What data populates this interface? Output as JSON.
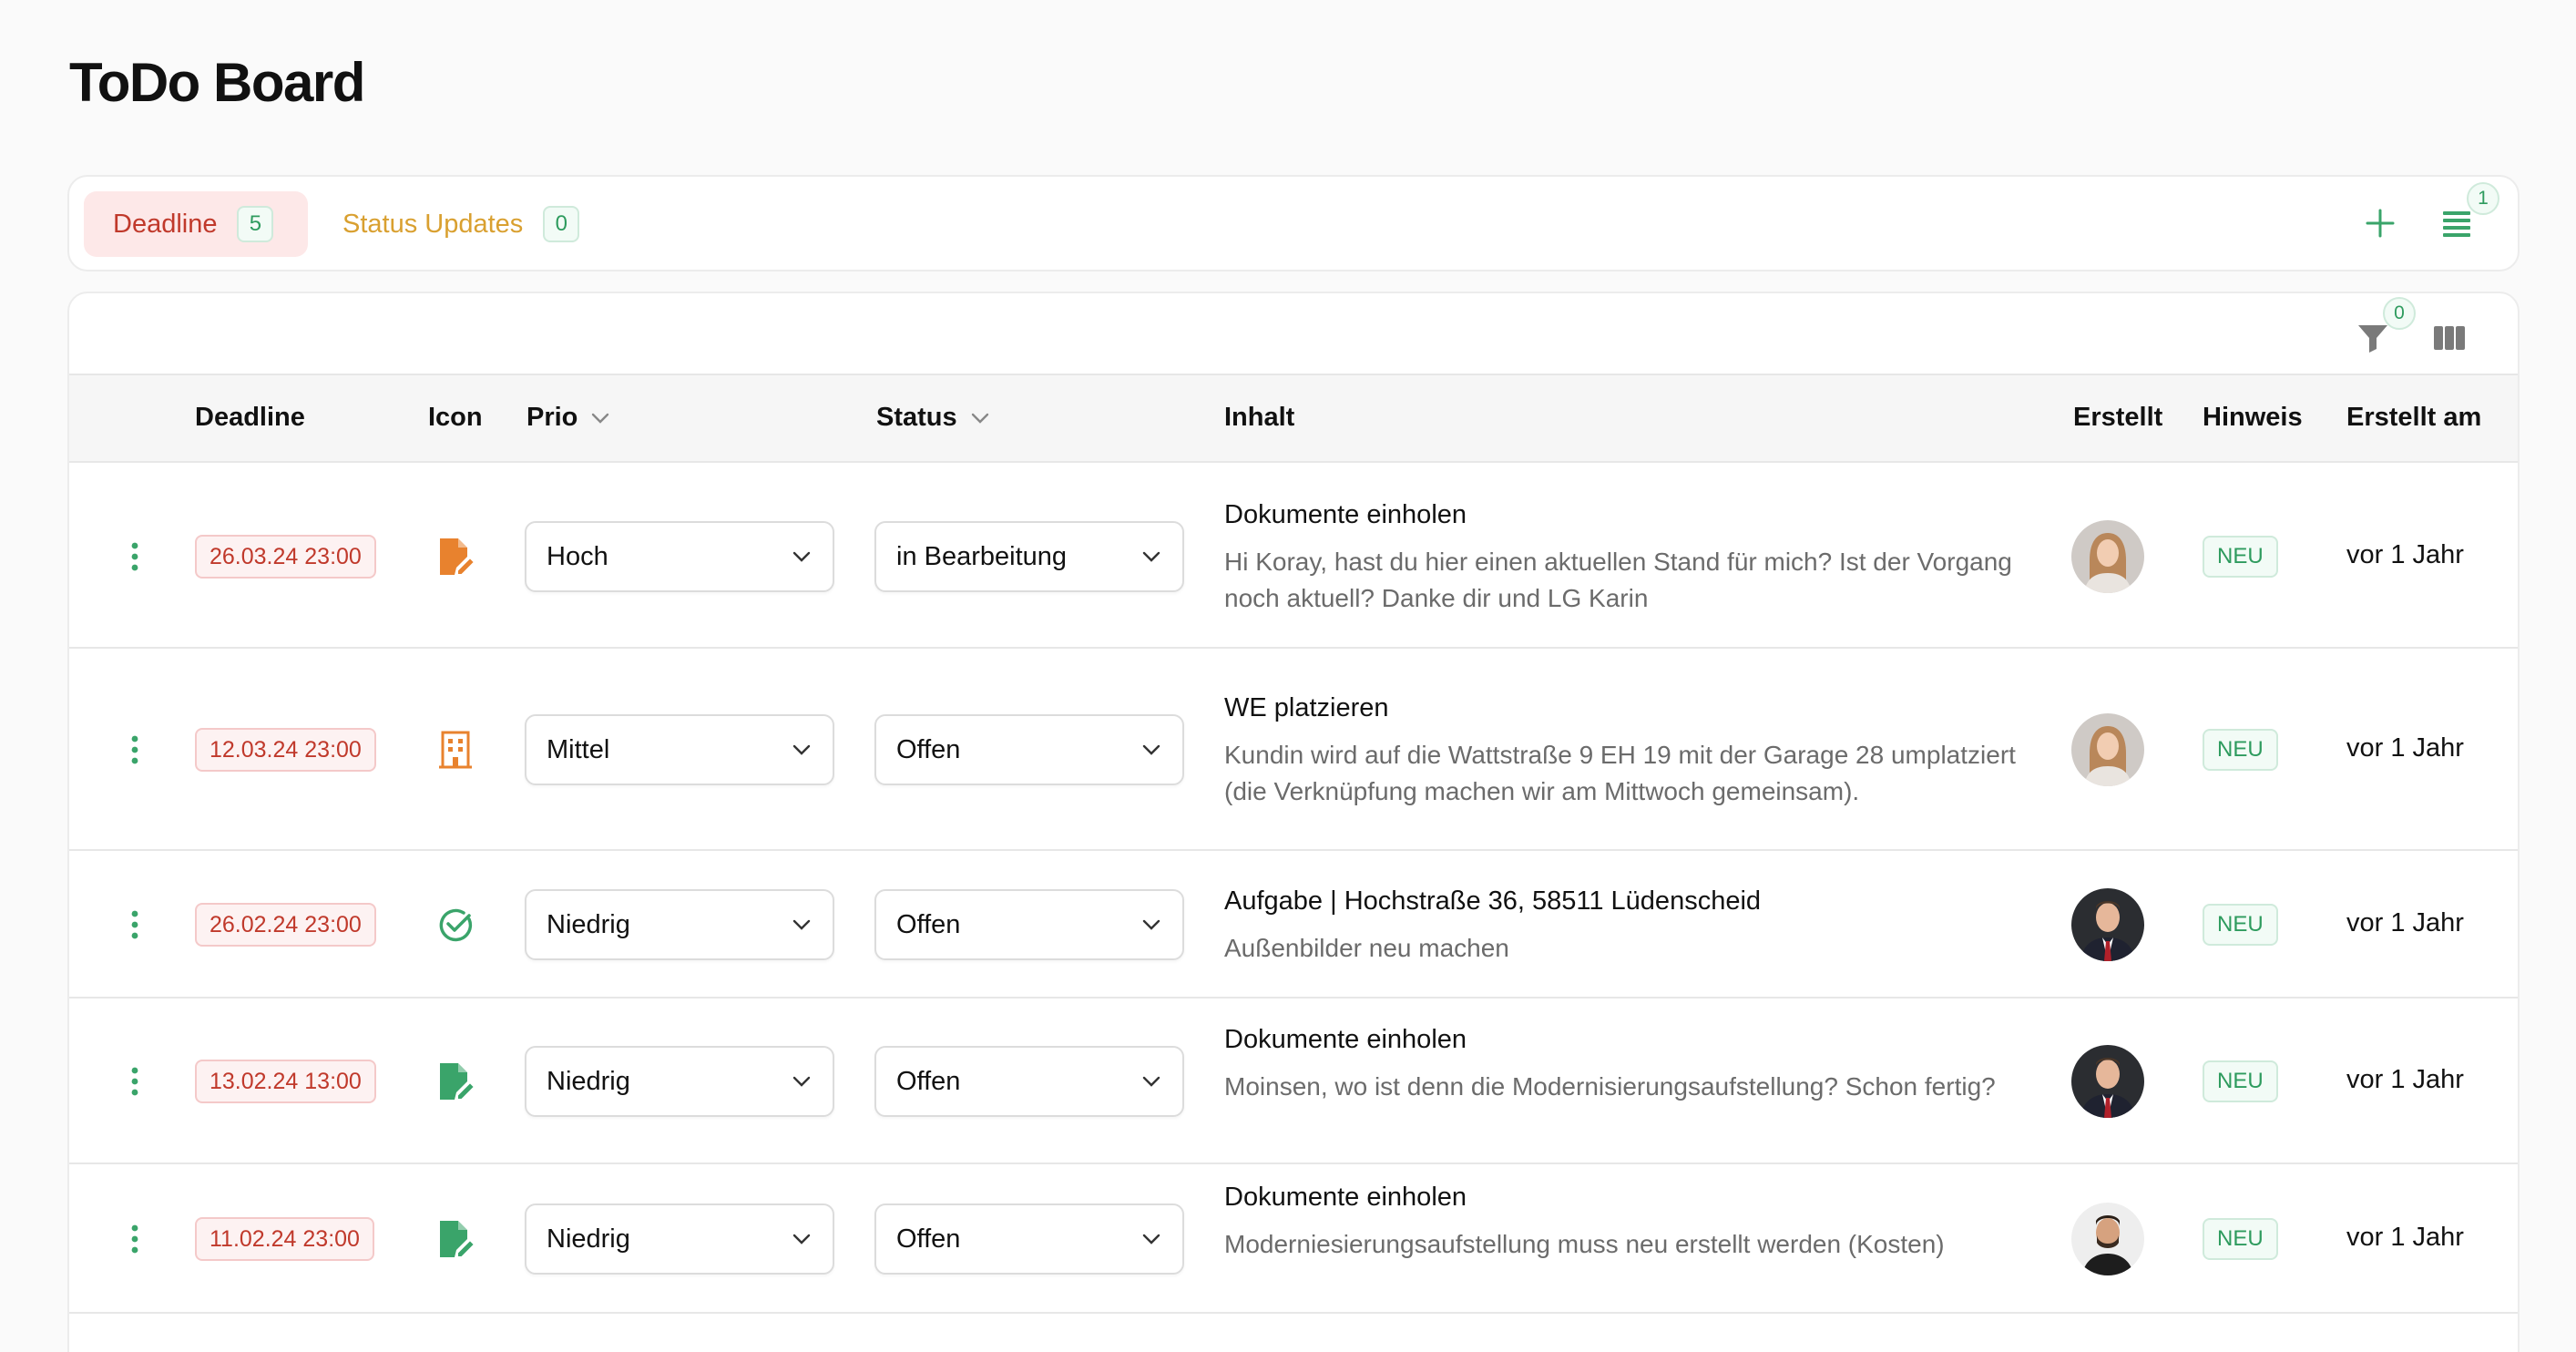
{
  "page": {
    "title": "ToDo Board"
  },
  "tabs": [
    {
      "label": "Deadline",
      "count": "5",
      "active": true
    },
    {
      "label": "Status Updates",
      "count": "0",
      "active": false
    }
  ],
  "tab_actions": {
    "add_icon": "plus-icon",
    "list_icon": "list-icon",
    "list_count": "1"
  },
  "toolbar": {
    "filter_icon": "filter-icon",
    "filter_count": "0",
    "columns_icon": "columns-icon"
  },
  "columns": {
    "deadline": "Deadline",
    "icon": "Icon",
    "prio": "Prio",
    "status": "Status",
    "inhalt": "Inhalt",
    "erstellt": "Erstellt",
    "hinweis": "Hinweis",
    "erstellt_am": "Erstellt am"
  },
  "rows": [
    {
      "deadline": "26.03.24 23:00",
      "icon": "document-edit-icon",
      "icon_color": "#e8822e",
      "prio": "Hoch",
      "status": "in Bearbeitung",
      "title": "Dokumente einholen",
      "text": "Hi Koray, hast du hier einen aktuellen Stand für mich? Ist der Vorgang noch aktuell? Danke dir und LG Karin",
      "avatar": "avatar-woman",
      "hinweis": "NEU",
      "created": "vor 1 Jahr"
    },
    {
      "deadline": "12.03.24 23:00",
      "icon": "building-icon",
      "icon_color": "#e8822e",
      "prio": "Mittel",
      "status": "Offen",
      "title": "WE platzieren",
      "text": "Kundin wird auf die Wattstraße 9 EH 19 mit der Garage 28 umplatziert (die Verknüpfung machen wir am Mittwoch gemeinsam).",
      "avatar": "avatar-woman",
      "hinweis": "NEU",
      "created": "vor 1 Jahr"
    },
    {
      "deadline": "26.02.24 23:00",
      "icon": "check-circle-icon",
      "icon_color": "#3aa46a",
      "prio": "Niedrig",
      "status": "Offen",
      "title": "Aufgabe | Hochstraße 36, 58511 Lüdenscheid",
      "text": "Außenbilder neu machen",
      "avatar": "avatar-man-suit",
      "hinweis": "NEU",
      "created": "vor 1 Jahr"
    },
    {
      "deadline": "13.02.24 13:00",
      "icon": "document-edit-icon",
      "icon_color": "#3aa46a",
      "prio": "Niedrig",
      "status": "Offen",
      "title": "Dokumente einholen",
      "text": "Moinsen, wo ist denn die Modernisierungsaufstellung? Schon fertig?",
      "avatar": "avatar-man-suit",
      "hinweis": "NEU",
      "created": "vor 1 Jahr"
    },
    {
      "deadline": "11.02.24 23:00",
      "icon": "document-edit-icon",
      "icon_color": "#3aa46a",
      "prio": "Niedrig",
      "status": "Offen",
      "title": "Dokumente einholen",
      "text": "Moderniesierungsaufstellung muss neu erstellt werden (Kosten)",
      "avatar": "avatar-man-beard",
      "hinweis": "NEU",
      "created": "vor 1 Jahr"
    }
  ],
  "colors": {
    "accent": "#2e9b5e",
    "danger": "#c0392b",
    "warning": "#d9a030"
  }
}
